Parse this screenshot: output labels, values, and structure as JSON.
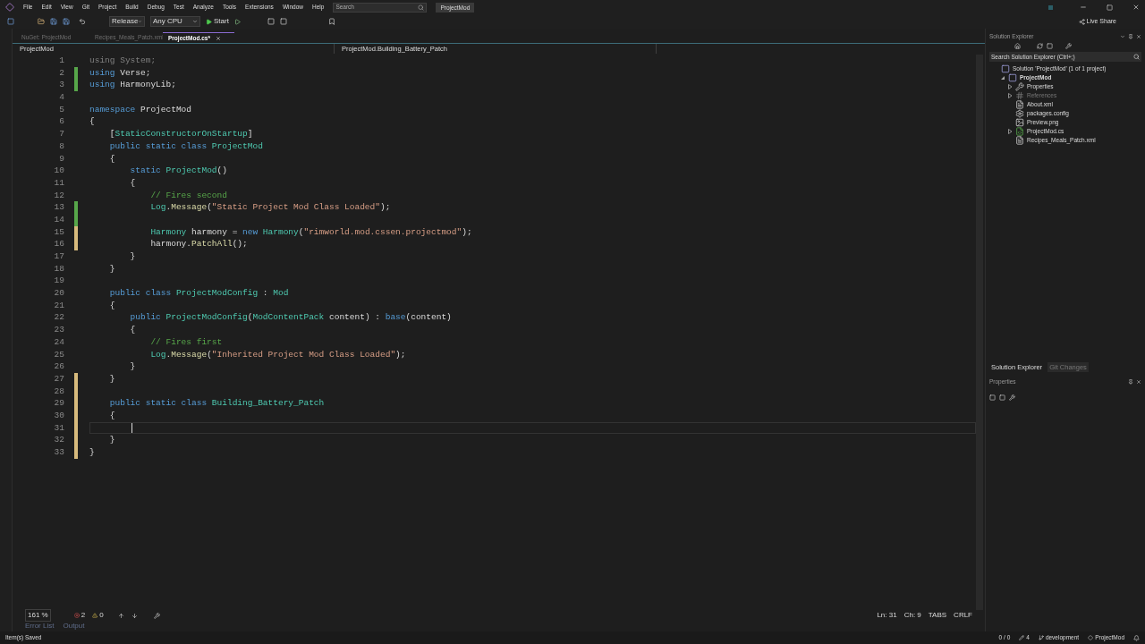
{
  "menu_bar": {
    "items": [
      "File",
      "Edit",
      "View",
      "Git",
      "Project",
      "Build",
      "Debug",
      "Test",
      "Analyze",
      "Tools",
      "Extensions",
      "Window",
      "Help"
    ],
    "search": {
      "placeholder": "Search"
    },
    "solution_name": "ProjectMod"
  },
  "toolbar": {
    "configuration": "Release",
    "platform": "Any CPU",
    "start": "Start"
  },
  "live_share": "Live Share",
  "tabs": [
    {
      "label": "NuGet: ProjectMod",
      "selected": false
    },
    {
      "label": "Recipes_Meals_Patch.xml",
      "selected": false
    },
    {
      "label": "ProjectMod.cs*",
      "selected": true
    }
  ],
  "nav_bar": {
    "project": "ProjectMod",
    "member": "ProjectMod.Building_Battery_Patch"
  },
  "editor": {
    "lines": [
      {
        "number": "1",
        "tokens": [
          {
            "kind": "dim",
            "text": "using System;"
          }
        ]
      },
      {
        "number": "2",
        "color": "#57a64a",
        "tokens": [
          {
            "kind": "keyword",
            "text": "using"
          },
          {
            "kind": "plain",
            "text": " Verse;"
          }
        ]
      },
      {
        "number": "3",
        "color": "#57a64a",
        "tokens": [
          {
            "kind": "keyword",
            "text": "using"
          },
          {
            "kind": "plain",
            "text": " HarmonyLib;"
          }
        ]
      },
      {
        "number": "4"
      },
      {
        "number": "5",
        "tokens": [
          {
            "kind": "keyword",
            "text": "namespace"
          },
          {
            "kind": "plain",
            "text": " ProjectMod"
          }
        ]
      },
      {
        "number": "6",
        "tokens": [
          {
            "kind": "plain",
            "text": "{"
          }
        ]
      },
      {
        "number": "7",
        "tokens": [
          {
            "kind": "plain",
            "text": "    ["
          },
          {
            "kind": "type",
            "text": "StaticConstructorOnStartup"
          },
          {
            "kind": "plain",
            "text": "]"
          }
        ]
      },
      {
        "number": "8",
        "tokens": [
          {
            "kind": "keyword",
            "text": "    public static class"
          },
          {
            "kind": "type",
            "text": " ProjectMod"
          }
        ]
      },
      {
        "number": "9",
        "tokens": [
          {
            "kind": "plain",
            "text": "    {"
          }
        ]
      },
      {
        "number": "10",
        "tokens": [
          {
            "kind": "keyword",
            "text": "        static"
          },
          {
            "kind": "type",
            "text": " ProjectMod"
          },
          {
            "kind": "plain",
            "text": "()"
          }
        ]
      },
      {
        "number": "11",
        "tokens": [
          {
            "kind": "plain",
            "text": "        {"
          }
        ]
      },
      {
        "number": "12",
        "tokens": [
          {
            "kind": "comment",
            "text": "            // Fires second"
          }
        ]
      },
      {
        "number": "13",
        "color": "#57a64a",
        "tokens": [
          {
            "kind": "type",
            "text": "            Log"
          },
          {
            "kind": "plain",
            "text": "."
          },
          {
            "kind": "method",
            "text": "Message"
          },
          {
            "kind": "plain",
            "text": "("
          },
          {
            "kind": "string",
            "text": "\"Static Project Mod Class Loaded\""
          },
          {
            "kind": "plain",
            "text": ");"
          }
        ]
      },
      {
        "number": "14",
        "color": "#57a64a"
      },
      {
        "number": "15",
        "color": "#d7ba7d",
        "tokens": [
          {
            "kind": "type",
            "text": "            Harmony"
          },
          {
            "kind": "plain",
            "text": " harmony = "
          },
          {
            "kind": "keyword",
            "text": "new"
          },
          {
            "kind": "type",
            "text": " Harmony"
          },
          {
            "kind": "plain",
            "text": "("
          },
          {
            "kind": "string",
            "text": "\"rimworld.mod.cssen.projectmod\""
          },
          {
            "kind": "plain",
            "text": ");"
          }
        ]
      },
      {
        "number": "16",
        "color": "#d7ba7d",
        "tokens": [
          {
            "kind": "plain",
            "text": "            harmony."
          },
          {
            "kind": "method",
            "text": "PatchAll"
          },
          {
            "kind": "plain",
            "text": "();"
          }
        ]
      },
      {
        "number": "17",
        "tokens": [
          {
            "kind": "plain",
            "text": "        }"
          }
        ]
      },
      {
        "number": "18",
        "tokens": [
          {
            "kind": "plain",
            "text": "    }"
          }
        ]
      },
      {
        "number": "19"
      },
      {
        "number": "20",
        "tokens": [
          {
            "kind": "keyword",
            "text": "    public class"
          },
          {
            "kind": "type",
            "text": " ProjectModConfig"
          },
          {
            "kind": "plain",
            "text": " : "
          },
          {
            "kind": "type",
            "text": "Mod"
          }
        ]
      },
      {
        "number": "21",
        "tokens": [
          {
            "kind": "plain",
            "text": "    {"
          }
        ]
      },
      {
        "number": "22",
        "tokens": [
          {
            "kind": "keyword",
            "text": "        public"
          },
          {
            "kind": "type",
            "text": " ProjectModConfig"
          },
          {
            "kind": "plain",
            "text": "("
          },
          {
            "kind": "type",
            "text": "ModContentPack"
          },
          {
            "kind": "plain",
            "text": " content) : "
          },
          {
            "kind": "keyword",
            "text": "base"
          },
          {
            "kind": "plain",
            "text": "(content)"
          }
        ]
      },
      {
        "number": "23",
        "tokens": [
          {
            "kind": "plain",
            "text": "        {"
          }
        ]
      },
      {
        "number": "24",
        "tokens": [
          {
            "kind": "comment",
            "text": "            // Fires first"
          }
        ]
      },
      {
        "number": "25",
        "tokens": [
          {
            "kind": "type",
            "text": "            Log"
          },
          {
            "kind": "plain",
            "text": "."
          },
          {
            "kind": "method",
            "text": "Message"
          },
          {
            "kind": "plain",
            "text": "("
          },
          {
            "kind": "string",
            "text": "\"Inherited Project Mod Class Loaded\""
          },
          {
            "kind": "plain",
            "text": ");"
          }
        ]
      },
      {
        "number": "26",
        "tokens": [
          {
            "kind": "plain",
            "text": "        }"
          }
        ]
      },
      {
        "number": "27",
        "color": "#d7ba7d",
        "tokens": [
          {
            "kind": "plain",
            "text": "    }"
          }
        ]
      },
      {
        "number": "28",
        "color": "#d7ba7d"
      },
      {
        "number": "29",
        "color": "#d7ba7d",
        "tokens": [
          {
            "kind": "keyword",
            "text": "    public static class"
          },
          {
            "kind": "type",
            "text": " Building_Battery_Patch"
          }
        ]
      },
      {
        "number": "30",
        "color": "#d7ba7d",
        "tokens": [
          {
            "kind": "plain",
            "text": "    {"
          }
        ]
      },
      {
        "number": "31",
        "color": "#d7ba7d",
        "caret": true
      },
      {
        "number": "32",
        "color": "#d7ba7d",
        "tokens": [
          {
            "kind": "plain",
            "text": "    }"
          }
        ]
      },
      {
        "number": "33",
        "color": "#d7ba7d",
        "tokens": [
          {
            "kind": "plain",
            "text": "}"
          }
        ]
      }
    ]
  },
  "editor_status": {
    "zoom": "161 %",
    "errors": "2",
    "warnings": "0",
    "line": "Ln: 31",
    "column": "Ch: 9",
    "indent": "TABS",
    "line_ending": "CRLF"
  },
  "bottom_tabs": [
    {
      "label": "Error List",
      "selected": false
    },
    {
      "label": "Output",
      "selected": false
    }
  ],
  "status_bar": {
    "message": "Item(s) Saved",
    "lines": "0 / 0",
    "edits": "4",
    "branch": "development",
    "repo": "ProjectMod"
  },
  "solution_explorer": {
    "title": "Solution Explorer",
    "search": {
      "placeholder": "Search Solution Explorer (Ctrl+;)"
    },
    "tree": [
      {
        "label": "Solution 'ProjectMod' (1 of 1 project)",
        "kind": "solution",
        "children": [
          {
            "label": "ProjectMod",
            "kind": "project",
            "expanded": true,
            "children": [
              {
                "label": "Properties",
                "kind": "properties",
                "expanded": false
              },
              {
                "label": "References",
                "kind": "references",
                "expanded": false
              },
              {
                "label": "About.xml",
                "kind": "xml"
              },
              {
                "label": "packages.config",
                "kind": "config"
              },
              {
                "label": "Preview.png",
                "kind": "image"
              },
              {
                "label": "ProjectMod.cs",
                "kind": "csharp",
                "expanded": false
              },
              {
                "label": "Recipes_Meals_Patch.xml",
                "kind": "xml"
              }
            ]
          }
        ]
      }
    ]
  },
  "panel_tabs": [
    {
      "label": "Solution Explorer",
      "selected": true
    },
    {
      "label": "Git Changes",
      "selected": false
    }
  ],
  "properties": {
    "title": "Properties"
  }
}
